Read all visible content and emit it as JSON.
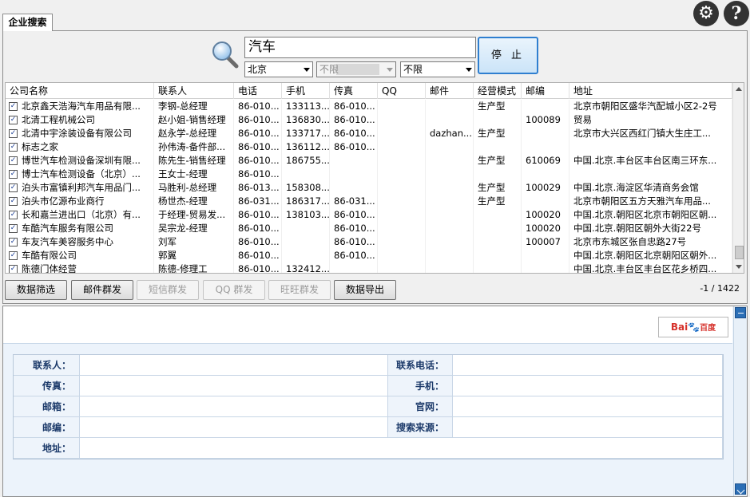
{
  "tab": {
    "label": "企业搜索"
  },
  "search": {
    "query": "汽车",
    "city": "北京",
    "district": "不限",
    "category": "不限",
    "stop_label": "停 止"
  },
  "grid": {
    "columns": [
      "公司名称",
      "联系人",
      "电话",
      "手机",
      "传真",
      "QQ",
      "邮件",
      "经营模式",
      "邮编",
      "地址"
    ],
    "rows": [
      [
        "北京鑫天浩海汽车用品有限...",
        "李钢-总经理",
        "86-010...",
        "133113...",
        "86-010...",
        "",
        "",
        "生产型",
        "",
        "北京市朝阳区盛华汽配城小区2-2号"
      ],
      [
        "北清工程机械公司",
        "赵小姐-销售经理",
        "86-010...",
        "136830...",
        "86-010...",
        "",
        "",
        "",
        "100089",
        "贸易"
      ],
      [
        "北清中宇涂装设备有限公司",
        "赵永学-总经理",
        "86-010...",
        "133717...",
        "86-010...",
        "",
        "dazhan...",
        "生产型",
        "",
        "北京市大兴区西红门镇大生庄工..."
      ],
      [
        "标志之家",
        "孙伟涛-备件部...",
        "86-010...",
        "136112...",
        "86-010...",
        "",
        "",
        "",
        "",
        ""
      ],
      [
        "博世汽车检测设备深圳有限...",
        "陈先生-销售经理",
        "86-010...",
        "186755...",
        "",
        "",
        "",
        "生产型",
        "610069",
        "中国.北京.丰台区丰台区南三环东..."
      ],
      [
        "博士汽车检测设备（北京）...",
        "王女士-经理",
        "86-010...",
        "",
        "",
        "",
        "",
        "",
        "",
        ""
      ],
      [
        "泊头市富镇利邦汽车用品门...",
        "马胜利-总经理",
        "86-013...",
        "158308...",
        "",
        "",
        "",
        "生产型",
        "100029",
        "中国.北京.海淀区华清商务会馆"
      ],
      [
        "泊头市亿源布业商行",
        "杨世杰-经理",
        "86-031...",
        "186317...",
        "86-031...",
        "",
        "",
        "生产型",
        "",
        "北京市朝阳区五方天雅汽车用品..."
      ],
      [
        "长和嘉兰进出口（北京）有...",
        "于经理-贸易发...",
        "86-010...",
        "138103...",
        "86-010...",
        "",
        "",
        "",
        "100020",
        "中国.北京.朝阳区北京市朝阳区朝..."
      ],
      [
        "车酷汽车服务有限公司",
        "吴宗龙-经理",
        "86-010...",
        "",
        "86-010...",
        "",
        "",
        "",
        "100020",
        "中国.北京.朝阳区朝外大街22号"
      ],
      [
        "车友汽车美容服务中心",
        "刘军",
        "86-010...",
        "",
        "86-010...",
        "",
        "",
        "",
        "100007",
        "北京市东城区张自忠路27号"
      ],
      [
        "车酷有限公司",
        "郭翼",
        "86-010...",
        "",
        "86-010...",
        "",
        "",
        "",
        "",
        "中国.北京.朝阳区北京朝阳区朝外..."
      ],
      [
        "陈德门体经营",
        "陈德-修理工",
        "86-010...",
        "132412...",
        "",
        "",
        "",
        "",
        "",
        "中国.北京.丰台区丰台区花乡桥四..."
      ]
    ]
  },
  "toolbar": {
    "buttons": [
      {
        "label": "数据筛选",
        "enabled": true
      },
      {
        "label": "邮件群发",
        "enabled": true
      },
      {
        "label": "短信群发",
        "enabled": false
      },
      {
        "label": "QQ 群发",
        "enabled": false
      },
      {
        "label": "旺旺群发",
        "enabled": false
      },
      {
        "label": "数据导出",
        "enabled": true
      }
    ],
    "count": "-1 / 1422"
  },
  "detail": {
    "baidu": {
      "bai": "Bai",
      "du": "du",
      "cn": "百度"
    },
    "labels": {
      "contact": "联系人：",
      "phone": "联系电话：",
      "fax": "传真：",
      "mobile": "手机：",
      "email": "邮箱：",
      "website": "官网：",
      "zip": "邮编：",
      "source": "搜索来源：",
      "address": "地址："
    }
  },
  "colors": {
    "accent": "#2f7fd0",
    "label_bg": "#eef4fb",
    "detail_bg": "#ecf3fb"
  },
  "icons": [
    "gear-icon",
    "help-icon",
    "search-icon",
    "checkbox-icon"
  ]
}
